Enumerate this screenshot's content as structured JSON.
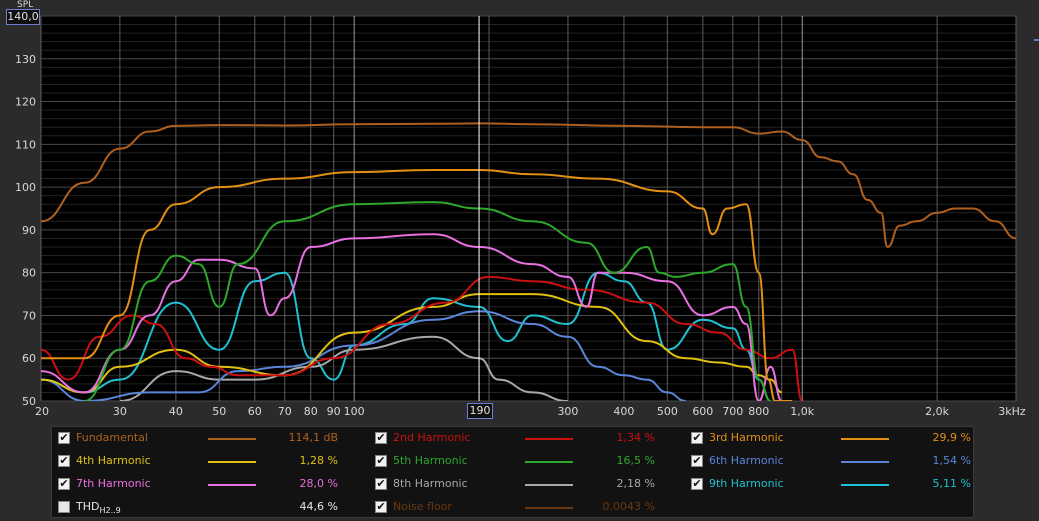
{
  "chart_data": {
    "type": "line",
    "ylabel": "SPL",
    "y_readout": "140,0",
    "x_readout": "190",
    "ylim": [
      50,
      140
    ],
    "xlim": [
      20,
      3000
    ],
    "x_scale": "log",
    "y_ticks": [
      "50",
      "60",
      "70",
      "80",
      "90",
      "100",
      "110",
      "120",
      "130"
    ],
    "x_ticks": [
      {
        "v": 20,
        "label": "20"
      },
      {
        "v": 30,
        "label": "30"
      },
      {
        "v": 40,
        "label": "40"
      },
      {
        "v": 50,
        "label": "50"
      },
      {
        "v": 60,
        "label": "60"
      },
      {
        "v": 70,
        "label": "70"
      },
      {
        "v": 80,
        "label": "80"
      },
      {
        "v": 90,
        "label": "90"
      },
      {
        "v": 100,
        "label": "100"
      },
      {
        "v": 200,
        "label": ""
      },
      {
        "v": 300,
        "label": "300"
      },
      {
        "v": 400,
        "label": "400"
      },
      {
        "v": 500,
        "label": "500"
      },
      {
        "v": 600,
        "label": "600"
      },
      {
        "v": 700,
        "label": "700"
      },
      {
        "v": 800,
        "label": "800"
      },
      {
        "v": 900,
        "label": ""
      },
      {
        "v": 1000,
        "label": "1,0k"
      },
      {
        "v": 2000,
        "label": "2,0k"
      },
      {
        "v": 3000,
        "label": "3kHz"
      }
    ],
    "cursor_x": 190,
    "grid": true,
    "legend_position": "bottom",
    "series": [
      {
        "name": "Fundamental",
        "color": "#b0601e",
        "value": "114,1 dB",
        "checked": true,
        "points": [
          [
            20,
            92
          ],
          [
            25,
            101
          ],
          [
            30,
            109
          ],
          [
            35,
            113
          ],
          [
            40,
            114.3
          ],
          [
            50,
            114.5
          ],
          [
            70,
            114.4
          ],
          [
            100,
            114.7
          ],
          [
            150,
            114.8
          ],
          [
            190,
            114.9
          ],
          [
            250,
            114.7
          ],
          [
            400,
            114.3
          ],
          [
            600,
            114
          ],
          [
            700,
            114
          ],
          [
            800,
            112.5
          ],
          [
            900,
            113
          ],
          [
            1000,
            111
          ],
          [
            1100,
            107
          ],
          [
            1200,
            106
          ],
          [
            1300,
            103
          ],
          [
            1400,
            97
          ],
          [
            1500,
            94
          ],
          [
            1550,
            86
          ],
          [
            1650,
            91
          ],
          [
            1800,
            92
          ],
          [
            2000,
            94
          ],
          [
            2200,
            95
          ],
          [
            2400,
            95
          ],
          [
            2700,
            92
          ],
          [
            3000,
            88
          ]
        ]
      },
      {
        "name": "2nd Harmonic",
        "color": "#cc1010",
        "value": "1,34 %",
        "checked": true,
        "points": [
          [
            20,
            62
          ],
          [
            23,
            55
          ],
          [
            27,
            65
          ],
          [
            32,
            70
          ],
          [
            36,
            68
          ],
          [
            42,
            60
          ],
          [
            48,
            58
          ],
          [
            55,
            56
          ],
          [
            70,
            56
          ],
          [
            90,
            60
          ],
          [
            120,
            68
          ],
          [
            160,
            73
          ],
          [
            200,
            79
          ],
          [
            250,
            78
          ],
          [
            330,
            76
          ],
          [
            450,
            73
          ],
          [
            550,
            68
          ],
          [
            650,
            66
          ],
          [
            750,
            62
          ],
          [
            850,
            60
          ],
          [
            950,
            62
          ],
          [
            1000,
            50
          ]
        ]
      },
      {
        "name": "3rd Harmonic",
        "color": "#e28f14",
        "value": "29,9 %",
        "checked": true,
        "points": [
          [
            20,
            60
          ],
          [
            25,
            60
          ],
          [
            30,
            70
          ],
          [
            35,
            90
          ],
          [
            40,
            96
          ],
          [
            50,
            100
          ],
          [
            70,
            102
          ],
          [
            100,
            103.5
          ],
          [
            150,
            104
          ],
          [
            190,
            104
          ],
          [
            250,
            103
          ],
          [
            350,
            102
          ],
          [
            500,
            99
          ],
          [
            600,
            95
          ],
          [
            630,
            89
          ],
          [
            680,
            95
          ],
          [
            750,
            96
          ],
          [
            800,
            80
          ],
          [
            840,
            55
          ],
          [
            870,
            50
          ],
          [
            950,
            50
          ]
        ]
      },
      {
        "name": "4th Harmonic",
        "color": "#e0c010",
        "value": "1,28 %",
        "checked": true,
        "points": [
          [
            20,
            55
          ],
          [
            25,
            52
          ],
          [
            30,
            58
          ],
          [
            40,
            62
          ],
          [
            50,
            58
          ],
          [
            70,
            56
          ],
          [
            100,
            66
          ],
          [
            150,
            72
          ],
          [
            190,
            75
          ],
          [
            250,
            75
          ],
          [
            350,
            72
          ],
          [
            450,
            64
          ],
          [
            550,
            60
          ],
          [
            650,
            59
          ],
          [
            750,
            58
          ],
          [
            800,
            56
          ],
          [
            850,
            55
          ],
          [
            900,
            52
          ]
        ]
      },
      {
        "name": "5th Harmonic",
        "color": "#2ca82c",
        "value": "16,5 %",
        "checked": true,
        "points": [
          [
            25,
            50
          ],
          [
            30,
            62
          ],
          [
            35,
            78
          ],
          [
            40,
            84
          ],
          [
            45,
            82
          ],
          [
            50,
            72
          ],
          [
            55,
            82
          ],
          [
            70,
            92
          ],
          [
            100,
            96
          ],
          [
            150,
            96.5
          ],
          [
            190,
            95
          ],
          [
            250,
            92
          ],
          [
            330,
            87
          ],
          [
            380,
            80
          ],
          [
            450,
            86
          ],
          [
            480,
            80
          ],
          [
            520,
            79
          ],
          [
            600,
            80
          ],
          [
            700,
            82
          ],
          [
            750,
            72
          ],
          [
            800,
            55
          ],
          [
            850,
            50
          ]
        ]
      },
      {
        "name": "6th Harmonic",
        "color": "#5a85d8",
        "value": "1,54 %",
        "checked": true,
        "points": [
          [
            20,
            55
          ],
          [
            25,
            50
          ],
          [
            35,
            52
          ],
          [
            45,
            52
          ],
          [
            55,
            57
          ],
          [
            70,
            58
          ],
          [
            100,
            63
          ],
          [
            150,
            69
          ],
          [
            190,
            71
          ],
          [
            250,
            68
          ],
          [
            300,
            65
          ],
          [
            350,
            58
          ],
          [
            400,
            56
          ],
          [
            450,
            55
          ],
          [
            500,
            52
          ],
          [
            550,
            50
          ]
        ]
      },
      {
        "name": "7th Harmonic",
        "color": "#e870e0",
        "value": "28,0 %",
        "checked": true,
        "points": [
          [
            20,
            57
          ],
          [
            25,
            52
          ],
          [
            30,
            62
          ],
          [
            35,
            70
          ],
          [
            40,
            78
          ],
          [
            45,
            83
          ],
          [
            50,
            83
          ],
          [
            60,
            81
          ],
          [
            65,
            70
          ],
          [
            70,
            74
          ],
          [
            80,
            86
          ],
          [
            100,
            88
          ],
          [
            150,
            89
          ],
          [
            190,
            86
          ],
          [
            250,
            82
          ],
          [
            300,
            79
          ],
          [
            330,
            72
          ],
          [
            350,
            80
          ],
          [
            400,
            80
          ],
          [
            500,
            78
          ],
          [
            600,
            70
          ],
          [
            700,
            72
          ],
          [
            750,
            68
          ],
          [
            800,
            50
          ],
          [
            850,
            58
          ],
          [
            900,
            50
          ]
        ]
      },
      {
        "name": "8th Harmonic",
        "color": "#a8a8a8",
        "value": "2,18 %",
        "checked": true,
        "points": [
          [
            30,
            50
          ],
          [
            40,
            57
          ],
          [
            50,
            55
          ],
          [
            60,
            55
          ],
          [
            80,
            58
          ],
          [
            100,
            62
          ],
          [
            150,
            65
          ],
          [
            190,
            60
          ],
          [
            210,
            55
          ],
          [
            250,
            52
          ],
          [
            300,
            50
          ]
        ]
      },
      {
        "name": "9th Harmonic",
        "color": "#20c0d0",
        "value": "5,11 %",
        "checked": true,
        "points": [
          [
            20,
            55
          ],
          [
            25,
            52
          ],
          [
            30,
            55
          ],
          [
            40,
            73
          ],
          [
            50,
            62
          ],
          [
            60,
            78
          ],
          [
            70,
            80
          ],
          [
            80,
            60
          ],
          [
            90,
            55
          ],
          [
            100,
            63
          ],
          [
            130,
            68
          ],
          [
            150,
            74
          ],
          [
            190,
            72
          ],
          [
            220,
            64
          ],
          [
            250,
            70
          ],
          [
            300,
            68
          ],
          [
            350,
            80
          ],
          [
            400,
            78
          ],
          [
            450,
            73
          ],
          [
            500,
            62
          ],
          [
            600,
            69
          ],
          [
            700,
            67
          ],
          [
            750,
            62
          ],
          [
            800,
            55
          ],
          [
            850,
            50
          ]
        ]
      },
      {
        "name": "THD",
        "name_sub": "H2..9",
        "color": "",
        "value": "44,6 %",
        "checked": false
      },
      {
        "name": "Noise floor",
        "color": "#6a3810",
        "value": "0,0043 %",
        "checked": true,
        "points": []
      }
    ]
  }
}
